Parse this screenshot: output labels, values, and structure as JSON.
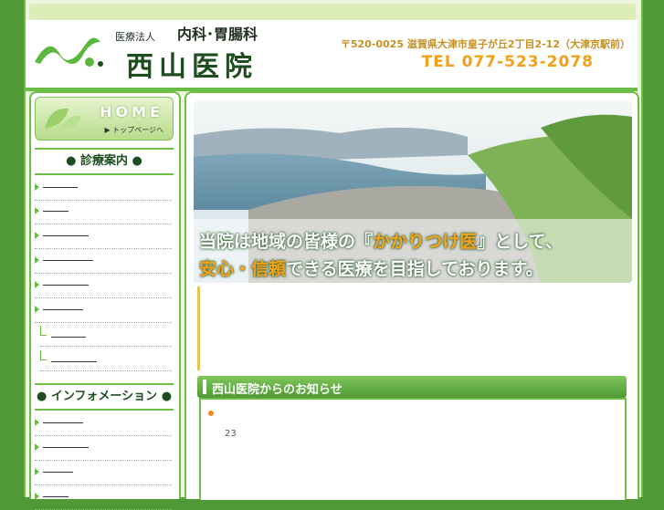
{
  "header": {
    "corporation": "医療法人",
    "departments": "内科･胃腸科",
    "clinic_name": "西山医院",
    "address": "〒520-0025 滋賀県大津市皇子が丘2丁目2-12（大津京駅前）",
    "tel": "TEL 077-523-2078"
  },
  "sidebar": {
    "home_label": "HOME",
    "home_sub": "▶ トップページへ",
    "section1_title": "● 診療案内 ●",
    "section2_title": "● インフォメーション ●"
  },
  "hero": {
    "line1_a": "当院は地域の皆様の『",
    "line1_hl": "かかりつけ医",
    "line1_b": "』として、",
    "line2_hl": "安心・信頼",
    "line2_b": "できる医療を目指しております。"
  },
  "news": {
    "title": "西山医院からのお知らせ",
    "item_number": "23"
  },
  "colors": {
    "accent_green": "#6cbd45",
    "highlight_orange": "#f5a21a"
  }
}
